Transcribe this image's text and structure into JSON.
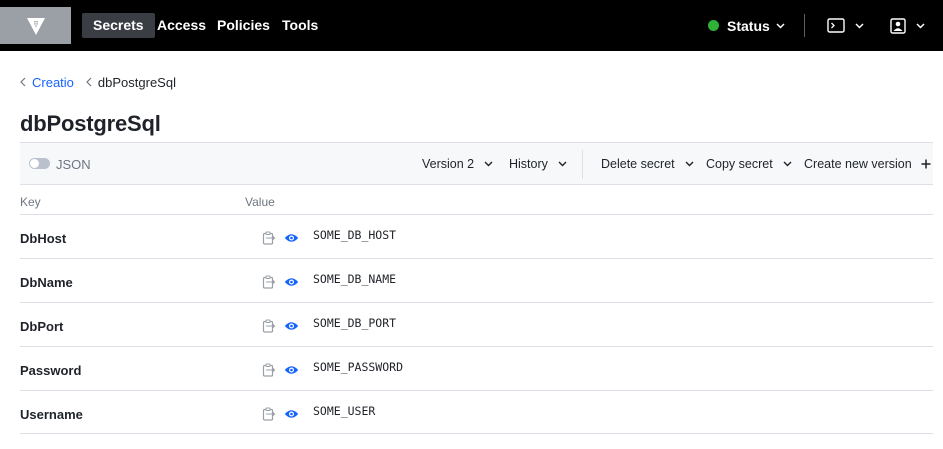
{
  "nav": {
    "items": [
      {
        "label": "Secrets",
        "active": true
      },
      {
        "label": "Access",
        "active": false
      },
      {
        "label": "Policies",
        "active": false
      },
      {
        "label": "Tools",
        "active": false
      }
    ],
    "status_label": "Status",
    "status_color": "#2eb039"
  },
  "breadcrumb": {
    "parent": "Creatio",
    "current": "dbPostgreSql"
  },
  "page": {
    "title": "dbPostgreSql"
  },
  "toolbar": {
    "json_label": "JSON",
    "json_enabled": false,
    "version_label": "Version 2",
    "history_label": "History",
    "delete_label": "Delete secret",
    "copy_label": "Copy secret",
    "create_label": "Create new version"
  },
  "table": {
    "columns": {
      "key": "Key",
      "value": "Value"
    },
    "rows": [
      {
        "key": "DbHost",
        "value": "SOME_DB_HOST"
      },
      {
        "key": "DbName",
        "value": "SOME_DB_NAME"
      },
      {
        "key": "DbPort",
        "value": "SOME_DB_PORT"
      },
      {
        "key": "Password",
        "value": "SOME_PASSWORD"
      },
      {
        "key": "Username",
        "value": "SOME_USER"
      }
    ]
  },
  "colors": {
    "accent": "#1563ff",
    "nav_bg": "#000000",
    "active_nav": "#3b3d45"
  }
}
